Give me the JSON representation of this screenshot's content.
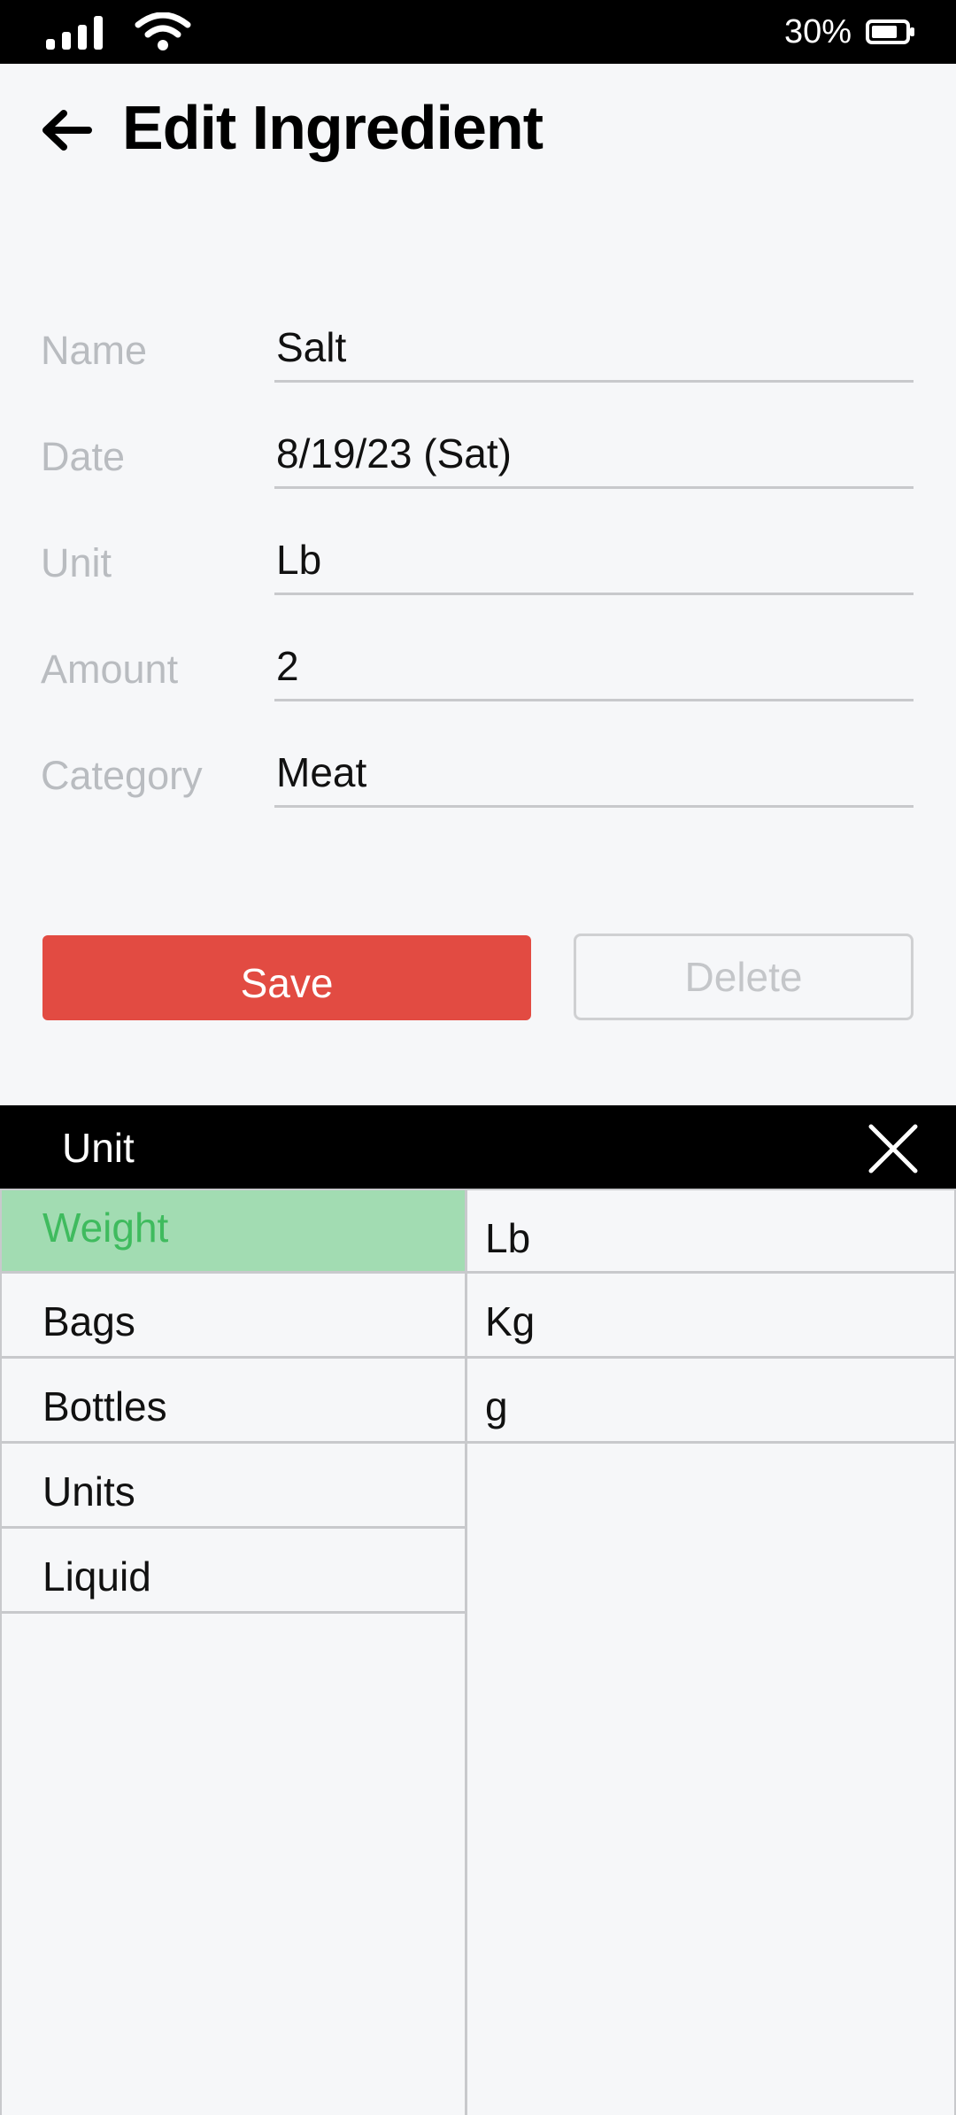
{
  "status_bar": {
    "battery_percent": "30%",
    "battery_level": 0.3,
    "signal_icon": "cellular-signal-icon",
    "wifi_icon": "wifi-icon",
    "battery_icon": "battery-icon"
  },
  "header": {
    "back_icon": "arrow-left-icon",
    "title": "Edit Ingredient"
  },
  "form": {
    "fields": [
      {
        "label": "Name",
        "value": "Salt"
      },
      {
        "label": "Date",
        "value": "8/19/23 (Sat)"
      },
      {
        "label": "Unit",
        "value": "Lb"
      },
      {
        "label": "Amount",
        "value": "2"
      },
      {
        "label": "Category",
        "value": "Meat"
      }
    ]
  },
  "actions": {
    "save_label": "Save",
    "delete_label": "Delete"
  },
  "unit_picker": {
    "title": "Unit",
    "close_icon": "close-icon",
    "categories": [
      {
        "label": "Weight",
        "selected": true
      },
      {
        "label": "Bags",
        "selected": false
      },
      {
        "label": "Bottles",
        "selected": false
      },
      {
        "label": "Units",
        "selected": false
      },
      {
        "label": "Liquid",
        "selected": false
      }
    ],
    "units": [
      {
        "label": "Lb"
      },
      {
        "label": "Kg"
      },
      {
        "label": "g"
      }
    ]
  },
  "colors": {
    "accent": "#e24b42",
    "selected_bg": "#a2dcb2",
    "selected_text": "#3fbb5e",
    "label_gray": "#b9bcc0",
    "background": "#f6f7f9"
  }
}
